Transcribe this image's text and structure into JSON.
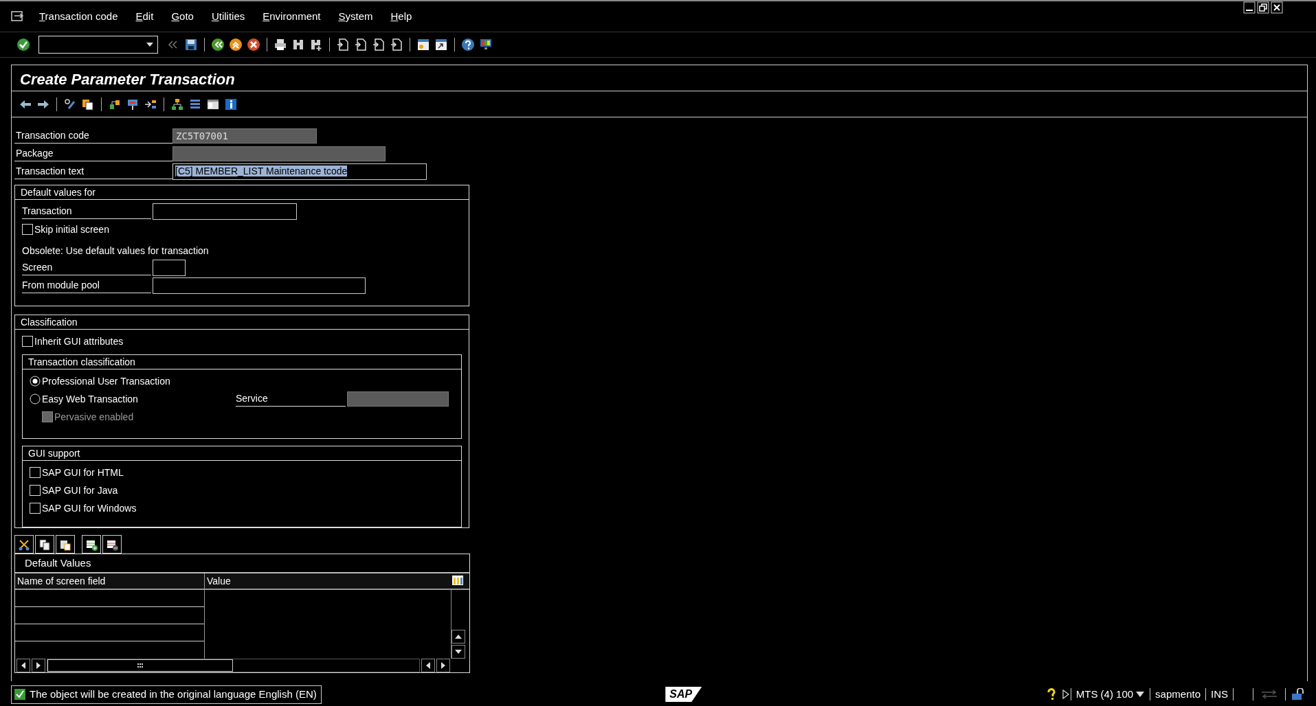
{
  "menu_bar": {
    "items": [
      "Transaction code",
      "Edit",
      "Goto",
      "Utilities",
      "Environment",
      "System",
      "Help"
    ]
  },
  "title": "Create Parameter Transaction",
  "header_fields": [
    {
      "label": "Transaction code",
      "kind": "readonly",
      "value": "ZC5T07001"
    },
    {
      "label": "Package",
      "kind": "readonly"
    },
    {
      "label": "Transaction text",
      "kind": "input",
      "value": "[C5] MEMBER_LIST Maintenance tcode",
      "text_selected": true
    }
  ],
  "default_values_for": {
    "title": "Default values for",
    "rows": [
      {
        "kind": "field",
        "label": "Transaction"
      },
      {
        "kind": "checkbox",
        "label": "Skip initial screen",
        "checked": false
      },
      {
        "kind": "note",
        "text": "Obsolete: Use default values for transaction"
      },
      {
        "kind": "field",
        "label": "Screen"
      },
      {
        "kind": "field",
        "label": "From module pool"
      }
    ]
  },
  "classification": {
    "title": "Classification",
    "inherit_gui": {
      "label": "Inherit GUI attributes",
      "checked": false
    },
    "transaction_classification": {
      "title": "Transaction classification",
      "options": [
        {
          "label": "Professional User Transaction",
          "selected": true
        },
        {
          "label": "Easy Web Transaction",
          "selected": false
        }
      ],
      "service_label": "Service",
      "pervasive": {
        "label": "Pervasive enabled",
        "checked": false,
        "disabled": true
      }
    },
    "gui_support": {
      "title": "GUI support",
      "options": [
        {
          "label": "SAP GUI for HTML",
          "checked": false
        },
        {
          "label": "SAP GUI for Java",
          "checked": false
        },
        {
          "label": "SAP GUI for Windows",
          "checked": false
        }
      ]
    }
  },
  "table": {
    "title": "Default Values",
    "columns": [
      "Name of screen field",
      "Value"
    ]
  },
  "status_bar": {
    "message": "The object will be created in the original language English (EN)",
    "logo": "SAP",
    "system": "MTS (4) 100",
    "user": "sapmento",
    "mode": "INS"
  }
}
